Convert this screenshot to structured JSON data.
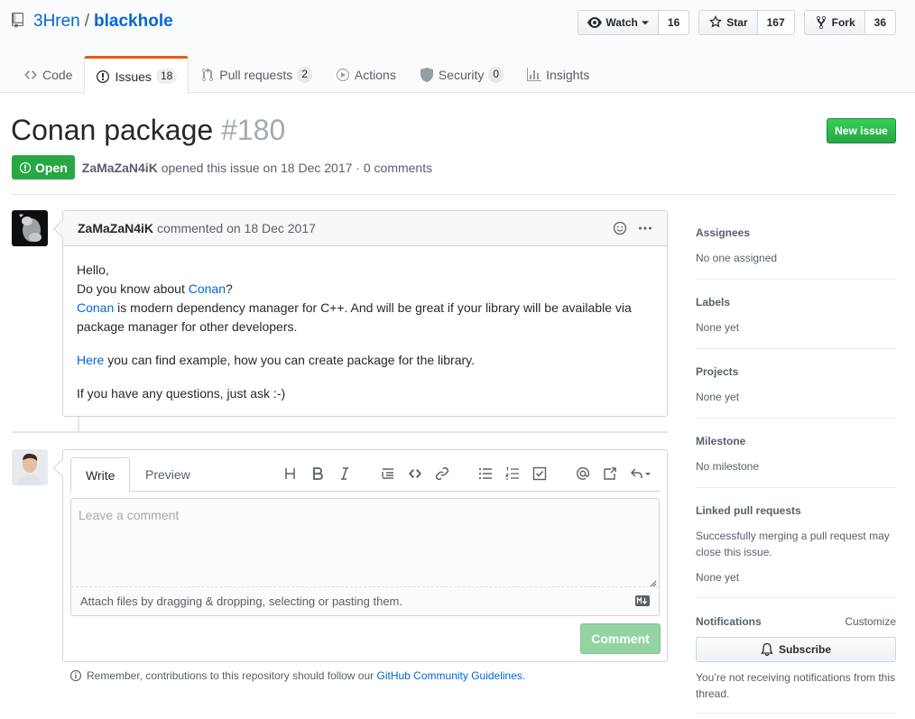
{
  "repo": {
    "owner": "3Hren",
    "separator": "/",
    "name": "blackhole",
    "watch_label": "Watch",
    "watch_count": "16",
    "star_label": "Star",
    "star_count": "167",
    "fork_label": "Fork",
    "fork_count": "36"
  },
  "nav": {
    "code": "Code",
    "issues": "Issues",
    "issues_count": "18",
    "pulls": "Pull requests",
    "pulls_count": "2",
    "actions": "Actions",
    "security": "Security",
    "security_count": "0",
    "insights": "Insights"
  },
  "issue": {
    "title": "Conan package",
    "number": "#180",
    "new_issue": "New issue",
    "state": "Open",
    "author": "ZaMaZaN4iK",
    "meta": "opened this issue on 18 Dec 2017 · 0 comments"
  },
  "comment": {
    "author": "ZaMaZaN4iK",
    "meta": "commented on 18 Dec 2017",
    "greeting": "Hello,",
    "line2_prefix": "Do you know about ",
    "line2_link": "Conan",
    "line2_suffix": "?",
    "line3_link": "Conan",
    "line3_text": " is modern dependency manager for C++. And will be great if your library will be available via package manager for other developers.",
    "para2_link": "Here",
    "para2_text": " you can find example, how you can create package for the library.",
    "para3": "If you have any questions, just ask :-)"
  },
  "form": {
    "tab_write": "Write",
    "tab_preview": "Preview",
    "placeholder": "Leave a comment",
    "attach_hint": "Attach files by dragging & dropping, selecting or pasting them.",
    "submit": "Comment",
    "guidelines_prefix": "Remember, contributions to this repository should follow our ",
    "guidelines_link": "GitHub Community Guidelines",
    "guidelines_suffix": "."
  },
  "sidebar": {
    "assignees_heading": "Assignees",
    "assignees_value": "No one assigned",
    "labels_heading": "Labels",
    "labels_value": "None yet",
    "projects_heading": "Projects",
    "projects_value": "None yet",
    "milestone_heading": "Milestone",
    "milestone_value": "No milestone",
    "linked_heading": "Linked pull requests",
    "linked_desc": "Successfully merging a pull request may close this issue.",
    "linked_value": "None yet",
    "notifications_heading": "Notifications",
    "customize": "Customize",
    "subscribe": "Subscribe",
    "notifications_desc": "You’re not receiving notifications from this thread."
  },
  "colors": {
    "accent_link": "#0366d6",
    "open_green": "#28a745",
    "tab_orange": "#e36209"
  }
}
